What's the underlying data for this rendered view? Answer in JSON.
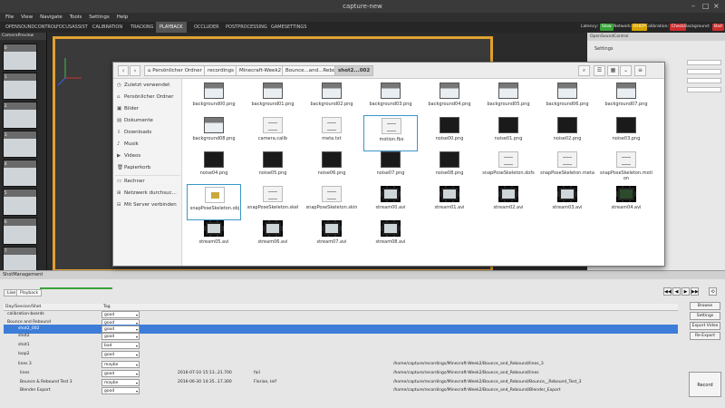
{
  "app": {
    "title": "capture-new",
    "window_controls": [
      "–",
      "□",
      "×"
    ]
  },
  "menu": [
    "File",
    "View",
    "Navigate",
    "Tools",
    "Settings",
    "Help"
  ],
  "tabs": [
    {
      "label": "OPENSOUNDCONTROL"
    },
    {
      "label": "FOCUSASSIST"
    },
    {
      "label": "CALIBRATION"
    },
    {
      "label": "TRACKING"
    },
    {
      "label": "PLAYBACK",
      "active": true
    },
    {
      "label": "OCCLUDER"
    },
    {
      "label": "POSTPROCESSING"
    },
    {
      "label": "GAMESETTINGS"
    }
  ],
  "status": {
    "latency_label": "Latency:",
    "latency_value": "Slow",
    "network_label": "Network:",
    "network_value": "DHCP",
    "calibration_label": "Calibration:",
    "calibration_value": "Check",
    "background_label": "Background:",
    "background_value": "Bad",
    "colors": {
      "slow": "#3aa33a",
      "dhcp": "#d6a400",
      "check": "#cc2d2d",
      "bad": "#cc2d2d"
    }
  },
  "camera_panel": {
    "title": "CameraPreview",
    "thumbs": [
      "0",
      "1",
      "2",
      "3",
      "4",
      "5",
      "6",
      "7"
    ]
  },
  "right_panel": {
    "title": "OpenSoundControl",
    "settings_label": "Settings"
  },
  "shot_panel": {
    "title": "ShotManagement",
    "subtabs": [
      "Live",
      "Playback"
    ],
    "column_headers": [
      "Day/Session/Shot",
      "Tag"
    ],
    "rows": [
      {
        "name": "calibration-boards",
        "tag": "good",
        "indent": 1
      },
      {
        "name": "Bounce and Rebound",
        "tag": "good",
        "indent": 1
      },
      {
        "name": "shot2_002",
        "tag": "good",
        "indent": 2,
        "selected": true
      },
      {
        "name": "shot2",
        "tag": "good",
        "indent": 2
      },
      {
        "name": "shot1",
        "tag": "bad",
        "indent": 2
      },
      {
        "name": "loop2",
        "tag": "good",
        "indent": 2
      },
      {
        "name": "lines 3",
        "tag": "maybe",
        "indent": 1,
        "path": "/home/capture/recordings/Minecraft-Week2/Bounce_and_Rebound/lines_3"
      },
      {
        "name": "lines",
        "tag": "good",
        "indent": 1,
        "date": "2016-07-10 15:13...",
        "duration": "21.700",
        "note": "fail",
        "path": "/home/capture/recordings/Minecraft-Week2/Bounce_and_Rebound/lines"
      },
      {
        "name": "Bounce & Rebound Test 3",
        "tag": "maybe",
        "indent": 1,
        "date": "2016-06-30 14:35...",
        "duration": "17.300",
        "note": "Florian, leif",
        "path": "/home/capture/recordings/Minecraft-Week2/Bounce_and_Rebound/Bounce__Rebound_Test_3"
      },
      {
        "name": "Blender Export",
        "tag": "good",
        "indent": 1,
        "path": "/home/capture/recordings/Minecraft-Week2/Bounce_and_Rebound/Blender_Export"
      }
    ],
    "buttons": {
      "browse": "Browse",
      "settings": "Settings",
      "export_video": "Export Video",
      "re_export": "Re-Export",
      "record": "Record"
    },
    "playback_controls": [
      "◀◀",
      "◀",
      "▶",
      "▶▶",
      "⟲"
    ]
  },
  "file_dialog": {
    "breadcrumbs": [
      "Persönlicher Ordner",
      "recordings",
      "Minecraft-Week2",
      "Bounce...and...Rebound",
      "shot2...002"
    ],
    "places": [
      {
        "label": "Zuletzt verwendet",
        "icon": "clock-icon",
        "glyph": "◷"
      },
      {
        "label": "Persönlicher Ordner",
        "icon": "home-icon",
        "glyph": "⌂"
      },
      {
        "label": "Bilder",
        "icon": "pictures-icon",
        "glyph": "▣"
      },
      {
        "label": "Dokumente",
        "icon": "documents-icon",
        "glyph": "▤"
      },
      {
        "label": "Downloads",
        "icon": "download-icon",
        "glyph": "⇩"
      },
      {
        "label": "Musik",
        "icon": "music-icon",
        "glyph": "♪"
      },
      {
        "label": "Videos",
        "icon": "video-icon",
        "glyph": "▶"
      },
      {
        "label": "Papierkorb",
        "icon": "trash-icon",
        "glyph": "🗑"
      },
      {
        "label": "Rechner",
        "icon": "computer-icon",
        "glyph": "▭"
      },
      {
        "label": "Netzwerk durchsuc...",
        "icon": "network-icon",
        "glyph": "⊞"
      },
      {
        "label": "Mit Server verbinden",
        "icon": "server-icon",
        "glyph": "⊟"
      }
    ],
    "files": [
      {
        "name": "background00.png",
        "kind": "img-lab"
      },
      {
        "name": "background01.png",
        "kind": "img-lab"
      },
      {
        "name": "background02.png",
        "kind": "img-lab"
      },
      {
        "name": "background03.png",
        "kind": "img-lab"
      },
      {
        "name": "background04.png",
        "kind": "img-lab"
      },
      {
        "name": "background05.png",
        "kind": "img-lab"
      },
      {
        "name": "background06.png",
        "kind": "img-lab"
      },
      {
        "name": "background07.png",
        "kind": "img-lab"
      },
      {
        "name": "background08.png",
        "kind": "img-lab"
      },
      {
        "name": "camera.calib",
        "kind": "doc"
      },
      {
        "name": "meta.txt",
        "kind": "doc"
      },
      {
        "name": "motion.fbx",
        "kind": "doc",
        "highlight": true
      },
      {
        "name": "noise00.png",
        "kind": "img-dark"
      },
      {
        "name": "noise01.png",
        "kind": "img-dark"
      },
      {
        "name": "noise02.png",
        "kind": "img-dark"
      },
      {
        "name": "noise03.png",
        "kind": "img-dark"
      },
      {
        "name": "noise04.png",
        "kind": "img-dark"
      },
      {
        "name": "noise05.png",
        "kind": "img-dark"
      },
      {
        "name": "noise06.png",
        "kind": "img-dark"
      },
      {
        "name": "noise07.png",
        "kind": "img-dark"
      },
      {
        "name": "noise08.png",
        "kind": "img-dark"
      },
      {
        "name": "snapPoseSkeleton.dofs",
        "kind": "doc"
      },
      {
        "name": "snapPoseSkeleton.meta",
        "kind": "doc"
      },
      {
        "name": "snapPoseSkeleton.motion",
        "kind": "doc"
      },
      {
        "name": "snapPoseSkeleton.obj",
        "kind": "ext",
        "highlight": true
      },
      {
        "name": "snapPoseSkeleton.skel",
        "kind": "doc"
      },
      {
        "name": "snapPoseSkeleton.skin",
        "kind": "doc"
      },
      {
        "name": "stream00.avi",
        "kind": "vid-light"
      },
      {
        "name": "stream01.avi",
        "kind": "vid-light"
      },
      {
        "name": "stream02.avi",
        "kind": "vid-light"
      },
      {
        "name": "stream03.avi",
        "kind": "vid-light"
      },
      {
        "name": "stream04.avi",
        "kind": "vid-green"
      },
      {
        "name": "stream05.avi",
        "kind": "vid-light"
      },
      {
        "name": "stream06.avi",
        "kind": "vid-light"
      },
      {
        "name": "stream07.avi",
        "kind": "vid-light"
      },
      {
        "name": "stream08.avi",
        "kind": "vid-light"
      }
    ]
  }
}
